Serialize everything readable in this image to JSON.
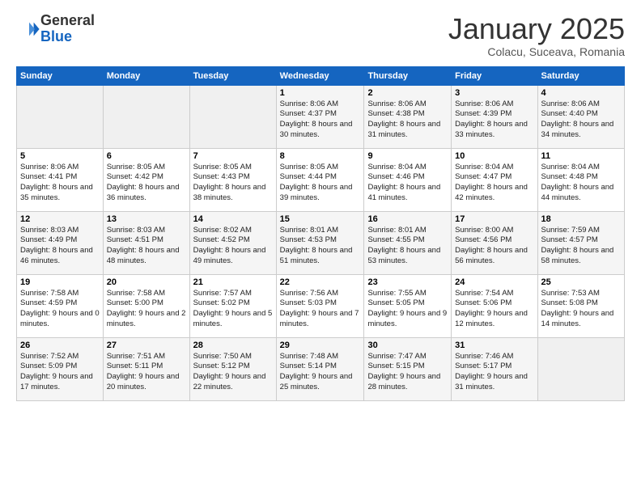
{
  "header": {
    "logo_line1": "General",
    "logo_line2": "Blue",
    "month": "January 2025",
    "location": "Colacu, Suceava, Romania"
  },
  "weekdays": [
    "Sunday",
    "Monday",
    "Tuesday",
    "Wednesday",
    "Thursday",
    "Friday",
    "Saturday"
  ],
  "weeks": [
    [
      {
        "day": "",
        "info": ""
      },
      {
        "day": "",
        "info": ""
      },
      {
        "day": "",
        "info": ""
      },
      {
        "day": "1",
        "info": "Sunrise: 8:06 AM\nSunset: 4:37 PM\nDaylight: 8 hours\nand 30 minutes."
      },
      {
        "day": "2",
        "info": "Sunrise: 8:06 AM\nSunset: 4:38 PM\nDaylight: 8 hours\nand 31 minutes."
      },
      {
        "day": "3",
        "info": "Sunrise: 8:06 AM\nSunset: 4:39 PM\nDaylight: 8 hours\nand 33 minutes."
      },
      {
        "day": "4",
        "info": "Sunrise: 8:06 AM\nSunset: 4:40 PM\nDaylight: 8 hours\nand 34 minutes."
      }
    ],
    [
      {
        "day": "5",
        "info": "Sunrise: 8:06 AM\nSunset: 4:41 PM\nDaylight: 8 hours\nand 35 minutes."
      },
      {
        "day": "6",
        "info": "Sunrise: 8:05 AM\nSunset: 4:42 PM\nDaylight: 8 hours\nand 36 minutes."
      },
      {
        "day": "7",
        "info": "Sunrise: 8:05 AM\nSunset: 4:43 PM\nDaylight: 8 hours\nand 38 minutes."
      },
      {
        "day": "8",
        "info": "Sunrise: 8:05 AM\nSunset: 4:44 PM\nDaylight: 8 hours\nand 39 minutes."
      },
      {
        "day": "9",
        "info": "Sunrise: 8:04 AM\nSunset: 4:46 PM\nDaylight: 8 hours\nand 41 minutes."
      },
      {
        "day": "10",
        "info": "Sunrise: 8:04 AM\nSunset: 4:47 PM\nDaylight: 8 hours\nand 42 minutes."
      },
      {
        "day": "11",
        "info": "Sunrise: 8:04 AM\nSunset: 4:48 PM\nDaylight: 8 hours\nand 44 minutes."
      }
    ],
    [
      {
        "day": "12",
        "info": "Sunrise: 8:03 AM\nSunset: 4:49 PM\nDaylight: 8 hours\nand 46 minutes."
      },
      {
        "day": "13",
        "info": "Sunrise: 8:03 AM\nSunset: 4:51 PM\nDaylight: 8 hours\nand 48 minutes."
      },
      {
        "day": "14",
        "info": "Sunrise: 8:02 AM\nSunset: 4:52 PM\nDaylight: 8 hours\nand 49 minutes."
      },
      {
        "day": "15",
        "info": "Sunrise: 8:01 AM\nSunset: 4:53 PM\nDaylight: 8 hours\nand 51 minutes."
      },
      {
        "day": "16",
        "info": "Sunrise: 8:01 AM\nSunset: 4:55 PM\nDaylight: 8 hours\nand 53 minutes."
      },
      {
        "day": "17",
        "info": "Sunrise: 8:00 AM\nSunset: 4:56 PM\nDaylight: 8 hours\nand 56 minutes."
      },
      {
        "day": "18",
        "info": "Sunrise: 7:59 AM\nSunset: 4:57 PM\nDaylight: 8 hours\nand 58 minutes."
      }
    ],
    [
      {
        "day": "19",
        "info": "Sunrise: 7:58 AM\nSunset: 4:59 PM\nDaylight: 9 hours\nand 0 minutes."
      },
      {
        "day": "20",
        "info": "Sunrise: 7:58 AM\nSunset: 5:00 PM\nDaylight: 9 hours\nand 2 minutes."
      },
      {
        "day": "21",
        "info": "Sunrise: 7:57 AM\nSunset: 5:02 PM\nDaylight: 9 hours\nand 5 minutes."
      },
      {
        "day": "22",
        "info": "Sunrise: 7:56 AM\nSunset: 5:03 PM\nDaylight: 9 hours\nand 7 minutes."
      },
      {
        "day": "23",
        "info": "Sunrise: 7:55 AM\nSunset: 5:05 PM\nDaylight: 9 hours\nand 9 minutes."
      },
      {
        "day": "24",
        "info": "Sunrise: 7:54 AM\nSunset: 5:06 PM\nDaylight: 9 hours\nand 12 minutes."
      },
      {
        "day": "25",
        "info": "Sunrise: 7:53 AM\nSunset: 5:08 PM\nDaylight: 9 hours\nand 14 minutes."
      }
    ],
    [
      {
        "day": "26",
        "info": "Sunrise: 7:52 AM\nSunset: 5:09 PM\nDaylight: 9 hours\nand 17 minutes."
      },
      {
        "day": "27",
        "info": "Sunrise: 7:51 AM\nSunset: 5:11 PM\nDaylight: 9 hours\nand 20 minutes."
      },
      {
        "day": "28",
        "info": "Sunrise: 7:50 AM\nSunset: 5:12 PM\nDaylight: 9 hours\nand 22 minutes."
      },
      {
        "day": "29",
        "info": "Sunrise: 7:48 AM\nSunset: 5:14 PM\nDaylight: 9 hours\nand 25 minutes."
      },
      {
        "day": "30",
        "info": "Sunrise: 7:47 AM\nSunset: 5:15 PM\nDaylight: 9 hours\nand 28 minutes."
      },
      {
        "day": "31",
        "info": "Sunrise: 7:46 AM\nSunset: 5:17 PM\nDaylight: 9 hours\nand 31 minutes."
      },
      {
        "day": "",
        "info": ""
      }
    ]
  ]
}
